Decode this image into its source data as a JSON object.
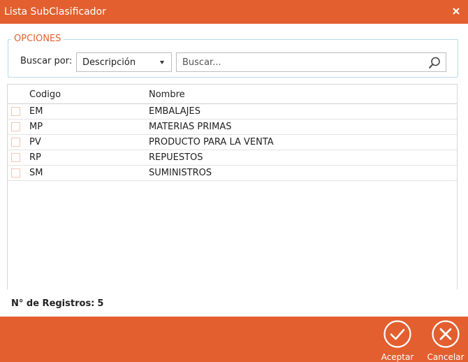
{
  "window": {
    "title": "Lista SubClasificador",
    "close_icon": "close-icon"
  },
  "options": {
    "legend": "OPCIONES",
    "search_by_label": "Buscar por:",
    "search_by_value": "Descripción",
    "search_placeholder": "Buscar...",
    "search_value": "",
    "search_icon": "search-icon"
  },
  "table": {
    "columns": [
      "Codigo",
      "Nombre"
    ],
    "rows": [
      {
        "code": "EM",
        "name": "EMBALAJES",
        "checked": false
      },
      {
        "code": "MP",
        "name": "MATERIAS PRIMAS",
        "checked": false
      },
      {
        "code": "PV",
        "name": "PRODUCTO PARA LA VENTA",
        "checked": false
      },
      {
        "code": "RP",
        "name": "REPUESTOS",
        "checked": false
      },
      {
        "code": "SM",
        "name": "SUMINISTROS",
        "checked": false
      }
    ]
  },
  "footer": {
    "records_label": "N° de Registros:",
    "records_count": "5",
    "accept_label": "Aceptar",
    "cancel_label": "Cancelar"
  },
  "colors": {
    "accent": "#e35f2f",
    "group_border": "#b8dbe8",
    "checkbox_border": "#f1c7b6"
  }
}
